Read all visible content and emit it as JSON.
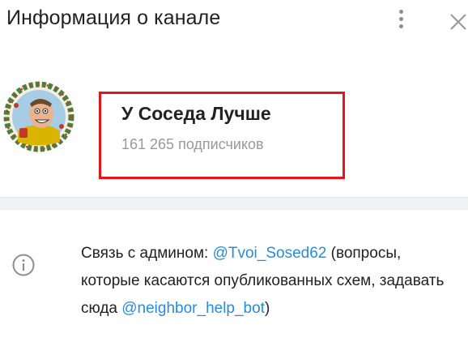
{
  "header": {
    "title": "Информация о канале"
  },
  "channel": {
    "name": "У Соседа Лучше",
    "subscribers": "161 265 подписчиков"
  },
  "description": {
    "part1": "Связь с админом: ",
    "link1": "@Tvoi_Sosed62",
    "part2": " (вопросы, которые касаются опубликованных схем, задавать сюда ",
    "link2": "@neighbor_help_bot",
    "part3": ")"
  },
  "colors": {
    "link": "#2a8bd8",
    "highlight_border": "#e3141e",
    "subtitle": "#999999"
  },
  "icons": {
    "menu": "more-vertical-icon",
    "close": "close-icon",
    "info": "info-icon"
  }
}
